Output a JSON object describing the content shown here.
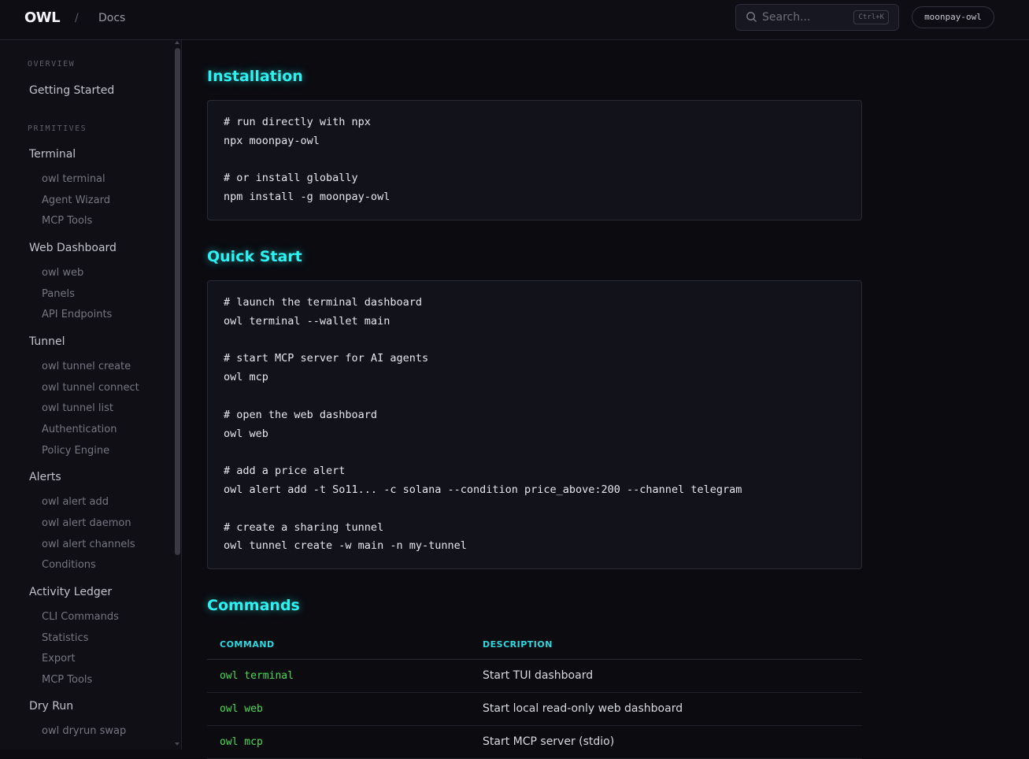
{
  "header": {
    "logo": "OWL",
    "breadcrumb_sep": "/",
    "breadcrumb_docs": "Docs",
    "search_placeholder": "Search...",
    "search_shortcut": "Ctrl+K",
    "repo_label": "moonpay-owl"
  },
  "sidebar": {
    "overview_label": "OVERVIEW",
    "getting_started": "Getting Started",
    "primitives_label": "PRIMITIVES",
    "groups": [
      {
        "title": "Terminal",
        "items": [
          "owl terminal",
          "Agent Wizard",
          "MCP Tools"
        ]
      },
      {
        "title": "Web Dashboard",
        "items": [
          "owl web",
          "Panels",
          "API Endpoints"
        ]
      },
      {
        "title": "Tunnel",
        "items": [
          "owl tunnel create",
          "owl tunnel connect",
          "owl tunnel list",
          "Authentication",
          "Policy Engine"
        ]
      },
      {
        "title": "Alerts",
        "items": [
          "owl alert add",
          "owl alert daemon",
          "owl alert channels",
          "Conditions"
        ]
      },
      {
        "title": "Activity Ledger",
        "items": [
          "CLI Commands",
          "Statistics",
          "Export",
          "MCP Tools"
        ]
      },
      {
        "title": "Dry Run",
        "items": [
          "owl dryrun swap"
        ]
      }
    ]
  },
  "main": {
    "installation": {
      "title": "Installation",
      "lines": [
        "# run directly with npx",
        "npx moonpay-owl",
        "",
        "# or install globally",
        "npm install -g moonpay-owl"
      ]
    },
    "quickstart": {
      "title": "Quick Start",
      "lines": [
        "# launch the terminal dashboard",
        "owl terminal --wallet main",
        "",
        "# start MCP server for AI agents",
        "owl mcp",
        "",
        "# open the web dashboard",
        "owl web",
        "",
        "# add a price alert",
        "owl alert add -t So11... -c solana --condition price_above:200 --channel telegram",
        "",
        "# create a sharing tunnel",
        "owl tunnel create -w main -n my-tunnel"
      ]
    },
    "commands": {
      "title": "Commands",
      "col_command": "COMMAND",
      "col_description": "DESCRIPTION",
      "rows": [
        {
          "command": "owl terminal",
          "description": "Start TUI dashboard"
        },
        {
          "command": "owl web",
          "description": "Start local read-only web dashboard"
        },
        {
          "command": "owl mcp",
          "description": "Start MCP server (stdio)"
        }
      ]
    }
  }
}
